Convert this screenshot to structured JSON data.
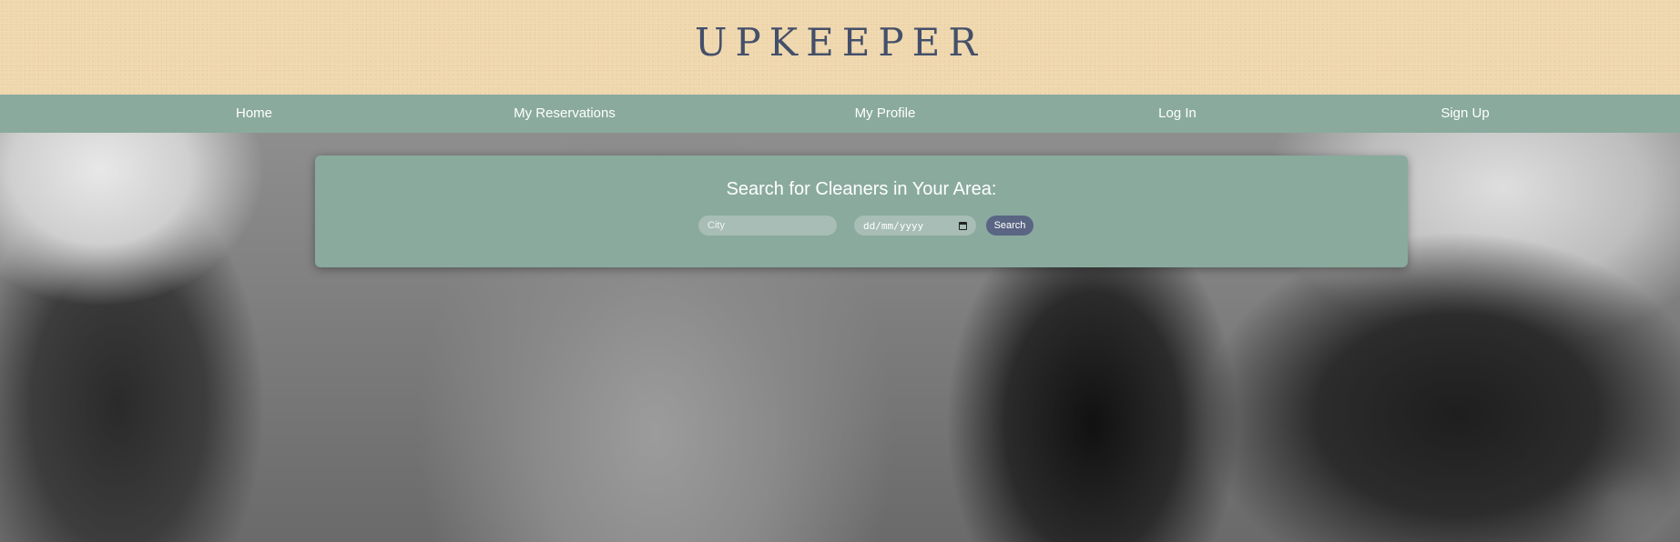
{
  "header": {
    "logo": "UPKEEPER"
  },
  "nav": {
    "items": [
      {
        "label": "Home"
      },
      {
        "label": "My Reservations"
      },
      {
        "label": "My Profile"
      },
      {
        "label": "Log In"
      },
      {
        "label": "Sign Up"
      }
    ]
  },
  "search": {
    "title": "Search for Cleaners in Your Area:",
    "city_placeholder": "City",
    "date_placeholder": "dd/mm/yyyy",
    "button_label": "Search"
  },
  "colors": {
    "header_bg": "#efd6ab",
    "nav_bg": "#8aaa9e",
    "logo": "#44506a",
    "button": "#5a6584"
  },
  "icons": {
    "date_picker": "calendar-icon"
  }
}
